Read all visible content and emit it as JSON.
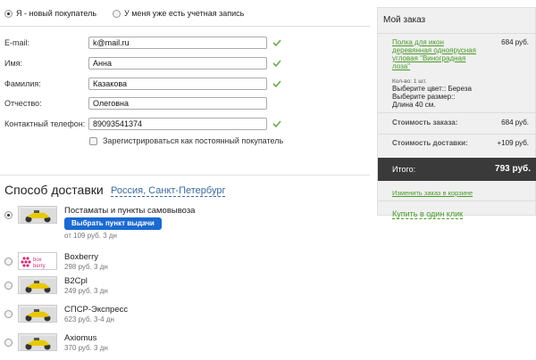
{
  "customer_type": {
    "new_label": "Я - новый покупатель",
    "existing_label": "У меня уже есть учетная запись",
    "selected": "new"
  },
  "form": {
    "email": {
      "label": "E-mail:",
      "value": "k@mail.ru"
    },
    "name": {
      "label": "Имя:",
      "value": "Анна"
    },
    "surname": {
      "label": "Фамилия:",
      "value": "Казакова"
    },
    "patronymic": {
      "label": "Отчество:",
      "value": "Олеговна"
    },
    "phone": {
      "label": "Контактный телефон:",
      "value": "89093541374"
    },
    "register_label": "Зарегистрироваться как постоянный покупатель"
  },
  "delivery": {
    "title": "Способ доставки",
    "city": "Россия, Санкт-Петербург",
    "pick_button": "Выбрать пункт выдачи",
    "items": [
      {
        "name": "Постаматы и пункты самовывоза",
        "sub": "от 109 руб. 3 дн",
        "selected": true
      },
      {
        "name": "Boxberry",
        "sub": "298 руб. 3 дн",
        "selected": false
      },
      {
        "name": "B2Cpl",
        "sub": "249 руб. 3 дн",
        "selected": false
      },
      {
        "name": "СПСР-Экспресс",
        "sub": "623 руб. 3-4 дн",
        "selected": false
      },
      {
        "name": "Axiomus",
        "sub": "370 руб. 3 дн",
        "selected": false
      }
    ],
    "boxberry_logo_text": "box berry"
  },
  "order": {
    "title": "Мой заказ",
    "product_name": "Полка для икон деревянная одноярусная угловая \"Виноградная лоза\"",
    "product_price": "684 руб.",
    "qty": "Кол-во: 1 шт.",
    "color": "Выберите цвет:: Береза",
    "size_label": "Выберите размер::",
    "size_value": "Длина 40 см.",
    "cost_label": "Стоимость заказа:",
    "cost_value": "684 руб.",
    "delivery_label": "Стоимость доставки:",
    "delivery_value": "+109 руб.",
    "total_label": "Итого:",
    "total_value": "793 руб.",
    "edit_link": "Изменить заказ в корзине",
    "one_click": "Купить в один клик"
  },
  "colors": {
    "accent_green": "#4a9a2a",
    "button_blue": "#1a6ad0",
    "total_bg": "#3a3a3a",
    "city_link": "#3a6aa0"
  }
}
